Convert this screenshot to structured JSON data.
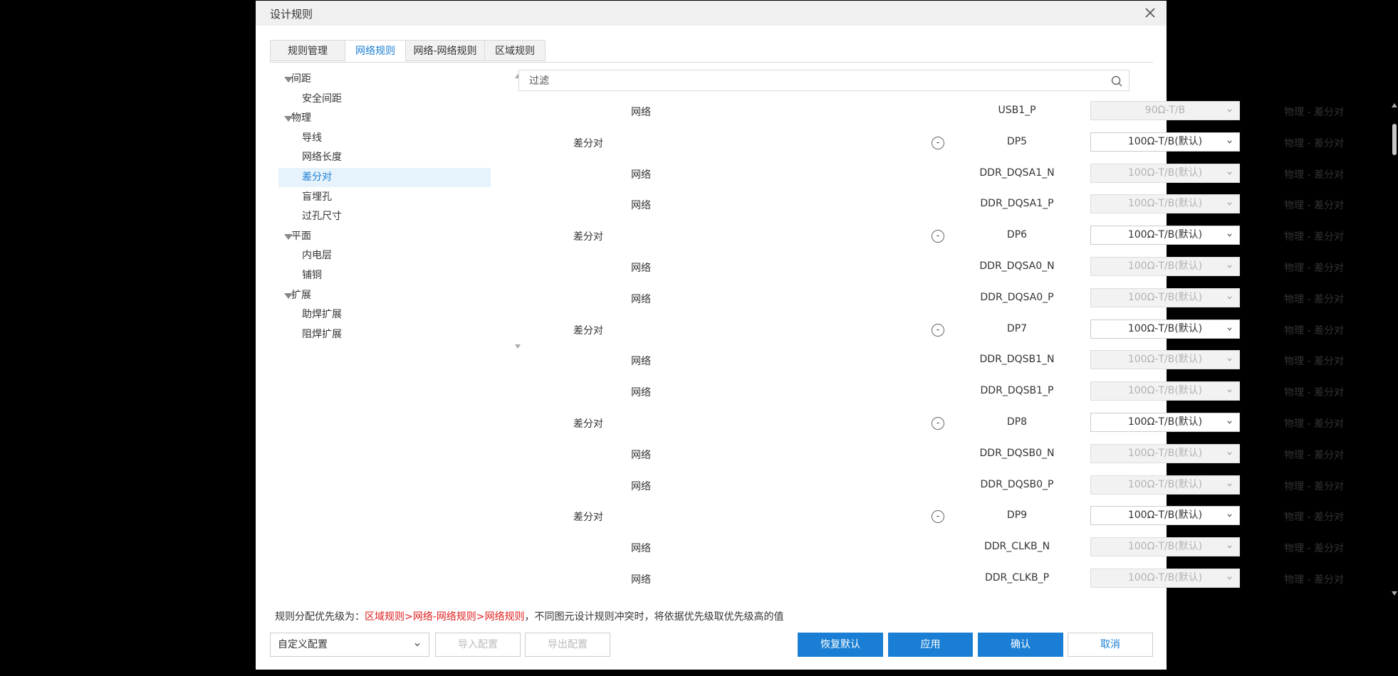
{
  "dialog": {
    "title": "设计规则"
  },
  "tabs": [
    {
      "label": "规则管理",
      "active": false
    },
    {
      "label": "网络规则",
      "active": true
    },
    {
      "label": "网络-网络规则",
      "active": false
    },
    {
      "label": "区域规则",
      "active": false
    }
  ],
  "tree": [
    {
      "label": "间距",
      "level": 0
    },
    {
      "label": "安全间距",
      "level": 1
    },
    {
      "label": "物理",
      "level": 0
    },
    {
      "label": "导线",
      "level": 1
    },
    {
      "label": "网络长度",
      "level": 1
    },
    {
      "label": "差分对",
      "level": 1,
      "selected": true
    },
    {
      "label": "盲埋孔",
      "level": 1
    },
    {
      "label": "过孔尺寸",
      "level": 1
    },
    {
      "label": "平面",
      "level": 0
    },
    {
      "label": "内电层",
      "level": 1
    },
    {
      "label": "铺铜",
      "level": 1
    },
    {
      "label": "扩展",
      "level": 0
    },
    {
      "label": "助焊扩展",
      "level": 1
    },
    {
      "label": "阻焊扩展",
      "level": 1
    }
  ],
  "filter": {
    "placeholder": "过滤"
  },
  "rows": [
    {
      "kind": "网络",
      "name": "USB1_P",
      "rule": "90Ω-T/B",
      "enabled": false,
      "category": "物理 - 差分对",
      "pair": false
    },
    {
      "kind": "差分对",
      "name": "DP5",
      "rule": "100Ω-T/B(默认)",
      "enabled": true,
      "category": "物理 - 差分对",
      "pair": true
    },
    {
      "kind": "网络",
      "name": "DDR_DQSA1_N",
      "rule": "100Ω-T/B(默认)",
      "enabled": false,
      "category": "物理 - 差分对",
      "pair": false
    },
    {
      "kind": "网络",
      "name": "DDR_DQSA1_P",
      "rule": "100Ω-T/B(默认)",
      "enabled": false,
      "category": "物理 - 差分对",
      "pair": false
    },
    {
      "kind": "差分对",
      "name": "DP6",
      "rule": "100Ω-T/B(默认)",
      "enabled": true,
      "category": "物理 - 差分对",
      "pair": true
    },
    {
      "kind": "网络",
      "name": "DDR_DQSA0_N",
      "rule": "100Ω-T/B(默认)",
      "enabled": false,
      "category": "物理 - 差分对",
      "pair": false
    },
    {
      "kind": "网络",
      "name": "DDR_DQSA0_P",
      "rule": "100Ω-T/B(默认)",
      "enabled": false,
      "category": "物理 - 差分对",
      "pair": false
    },
    {
      "kind": "差分对",
      "name": "DP7",
      "rule": "100Ω-T/B(默认)",
      "enabled": true,
      "category": "物理 - 差分对",
      "pair": true
    },
    {
      "kind": "网络",
      "name": "DDR_DQSB1_N",
      "rule": "100Ω-T/B(默认)",
      "enabled": false,
      "category": "物理 - 差分对",
      "pair": false
    },
    {
      "kind": "网络",
      "name": "DDR_DQSB1_P",
      "rule": "100Ω-T/B(默认)",
      "enabled": false,
      "category": "物理 - 差分对",
      "pair": false
    },
    {
      "kind": "差分对",
      "name": "DP8",
      "rule": "100Ω-T/B(默认)",
      "enabled": true,
      "category": "物理 - 差分对",
      "pair": true
    },
    {
      "kind": "网络",
      "name": "DDR_DQSB0_N",
      "rule": "100Ω-T/B(默认)",
      "enabled": false,
      "category": "物理 - 差分对",
      "pair": false
    },
    {
      "kind": "网络",
      "name": "DDR_DQSB0_P",
      "rule": "100Ω-T/B(默认)",
      "enabled": false,
      "category": "物理 - 差分对",
      "pair": false
    },
    {
      "kind": "差分对",
      "name": "DP9",
      "rule": "100Ω-T/B(默认)",
      "enabled": true,
      "category": "物理 - 差分对",
      "pair": true
    },
    {
      "kind": "网络",
      "name": "DDR_CLKB_N",
      "rule": "100Ω-T/B(默认)",
      "enabled": false,
      "category": "物理 - 差分对",
      "pair": false
    },
    {
      "kind": "网络",
      "name": "DDR_CLKB_P",
      "rule": "100Ω-T/B(默认)",
      "enabled": false,
      "category": "物理 - 差分对",
      "pair": false
    }
  ],
  "collapse_symbol": "-",
  "note": {
    "prefix": "规则分配优先级为：",
    "priority": "区域规则>网络-网络规则>网络规则",
    "suffix": "，不同图元设计规则冲突时，将依据优先级取优先级高的值"
  },
  "footer": {
    "preset": "自定义配置",
    "import": "导入配置",
    "export": "导出配置",
    "restore": "恢复默认",
    "apply": "应用",
    "confirm": "确认",
    "cancel": "取消"
  },
  "colors": {
    "accent": "#1a7fd4",
    "priority_text": "#e02020",
    "selected_bg": "#e6f2fc"
  }
}
